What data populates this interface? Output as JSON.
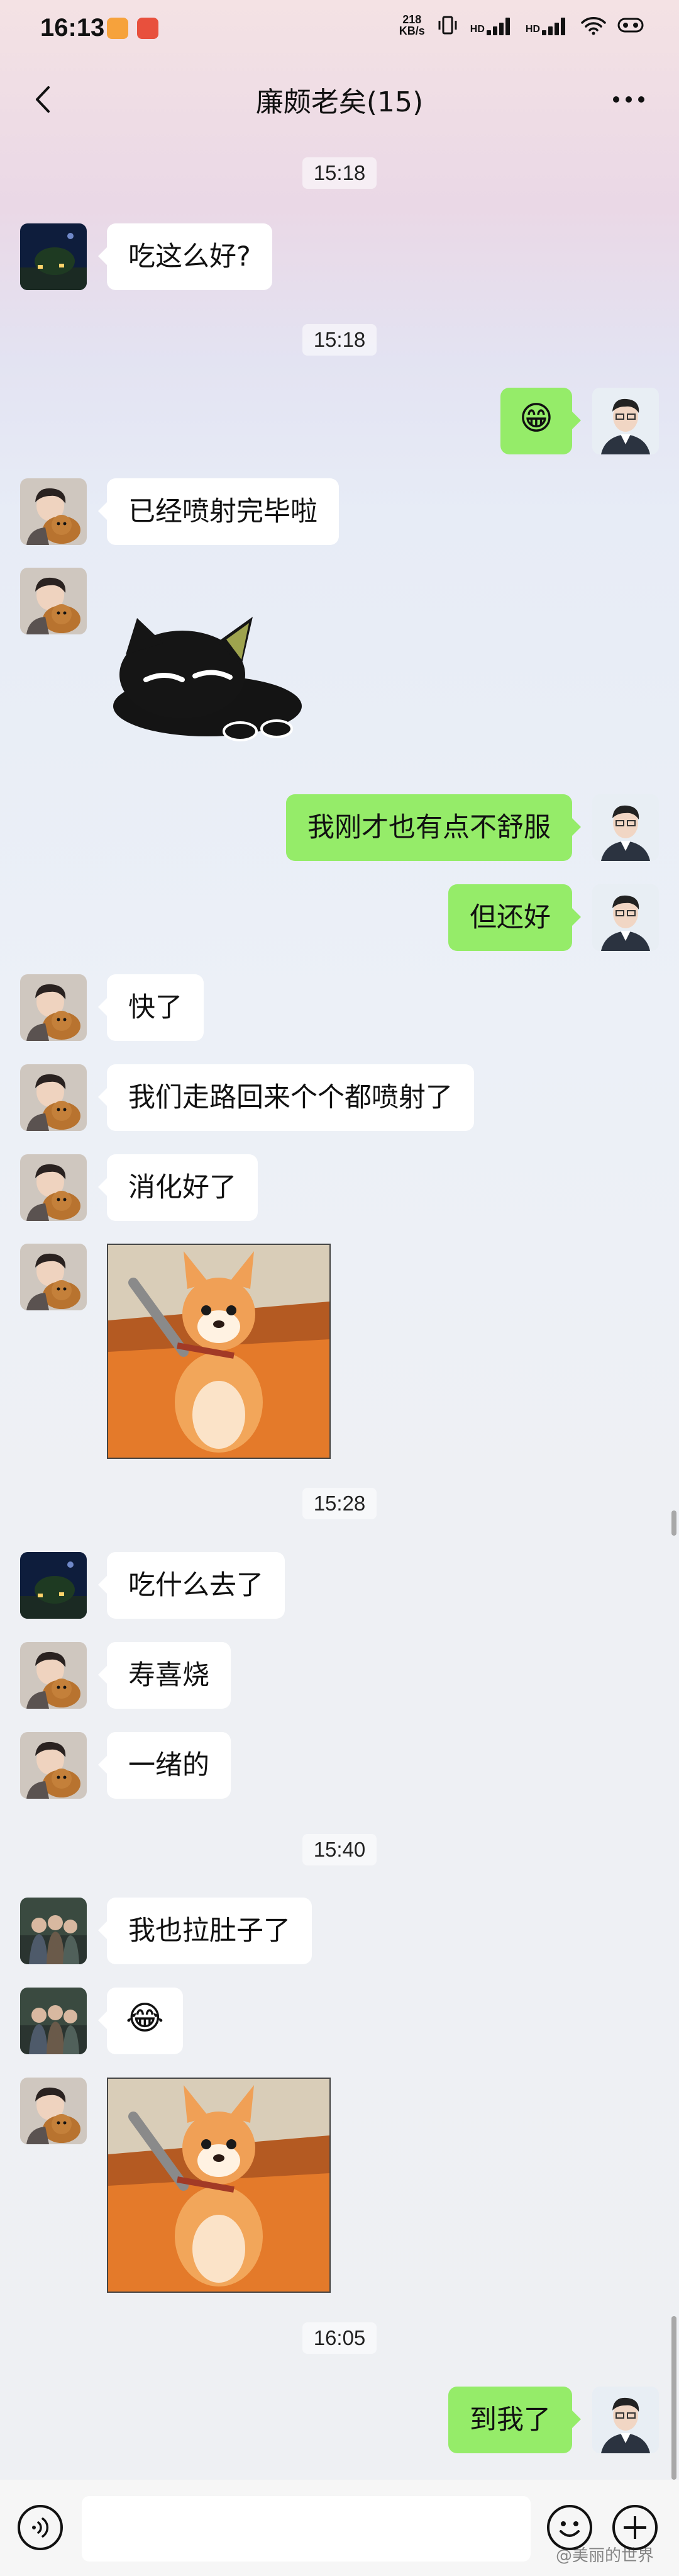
{
  "status_bar": {
    "time": "16:13",
    "net_speed_value": "218",
    "net_speed_unit": "KB/s",
    "network_1": "HD",
    "network_2": "HD"
  },
  "header": {
    "title": "廉颇老矣(15)"
  },
  "messages": [
    {
      "type": "time",
      "text": "15:18"
    },
    {
      "type": "text",
      "side": "left",
      "avatar": "night-house-avatar",
      "text": "吃这么好?"
    },
    {
      "type": "time",
      "text": "15:18"
    },
    {
      "type": "emoji",
      "side": "right",
      "avatar": "man-portrait-avatar",
      "text": "😁"
    },
    {
      "type": "text",
      "side": "left",
      "avatar": "man-with-dog-avatar",
      "text": "已经喷射完毕啦"
    },
    {
      "type": "sticker",
      "side": "left",
      "avatar": "man-with-dog-avatar",
      "sticker": "black-cat-lying-sticker"
    },
    {
      "type": "text",
      "side": "right",
      "avatar": "man-portrait-avatar",
      "text": "我刚才也有点不舒服"
    },
    {
      "type": "text",
      "side": "right",
      "avatar": "man-portrait-avatar",
      "text": "但还好"
    },
    {
      "type": "text",
      "side": "left",
      "avatar": "man-with-dog-avatar",
      "text": "快了"
    },
    {
      "type": "text",
      "side": "left",
      "avatar": "man-with-dog-avatar",
      "text": "我们走路回来个个都喷射了"
    },
    {
      "type": "text",
      "side": "left",
      "avatar": "man-with-dog-avatar",
      "text": "消化好了"
    },
    {
      "type": "image",
      "side": "left",
      "avatar": "man-with-dog-avatar",
      "image": "corgi-meme-image"
    },
    {
      "type": "time",
      "text": "15:28"
    },
    {
      "type": "text",
      "side": "left",
      "avatar": "night-house-avatar",
      "text": "吃什么去了"
    },
    {
      "type": "text",
      "side": "left",
      "avatar": "man-with-dog-avatar",
      "text": "寿喜烧"
    },
    {
      "type": "text",
      "side": "left",
      "avatar": "man-with-dog-avatar",
      "text": "一绪的"
    },
    {
      "type": "time",
      "text": "15:40"
    },
    {
      "type": "text",
      "side": "left",
      "avatar": "group-photo-avatar",
      "text": "我也拉肚子了"
    },
    {
      "type": "emoji",
      "side": "left",
      "avatar": "group-photo-avatar",
      "text": "😂"
    },
    {
      "type": "image",
      "side": "left",
      "avatar": "man-with-dog-avatar",
      "image": "corgi-meme-image"
    },
    {
      "type": "time",
      "text": "16:05"
    },
    {
      "type": "text",
      "side": "right",
      "avatar": "man-portrait-avatar",
      "text": "到我了"
    }
  ],
  "input_bar": {
    "placeholder": ""
  },
  "watermark": "@美丽的世界"
}
